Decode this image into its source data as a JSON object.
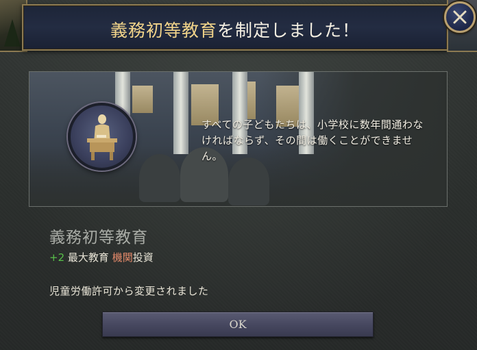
{
  "header": {
    "title_highlight": "義務初等教育",
    "title_rest": "を制定しました！"
  },
  "panel": {
    "description": "すべての子どもたちは、小学校に数年間通わなければならず、その間は働くことができません。"
  },
  "law": {
    "name": "義務初等教育",
    "effect": {
      "value": "+2",
      "text_before": "最大教育",
      "highlight": "機関",
      "text_after": "投資"
    },
    "changed_from": "児童労働許可から変更されました"
  },
  "buttons": {
    "ok_label": "OK"
  },
  "icons": {
    "close": "close-icon",
    "emblem": "teacher-at-desk-icon"
  },
  "colors": {
    "title_highlight": "#f2d48a",
    "positive_value": "#58c24a",
    "highlight_term": "#e58a6a"
  }
}
